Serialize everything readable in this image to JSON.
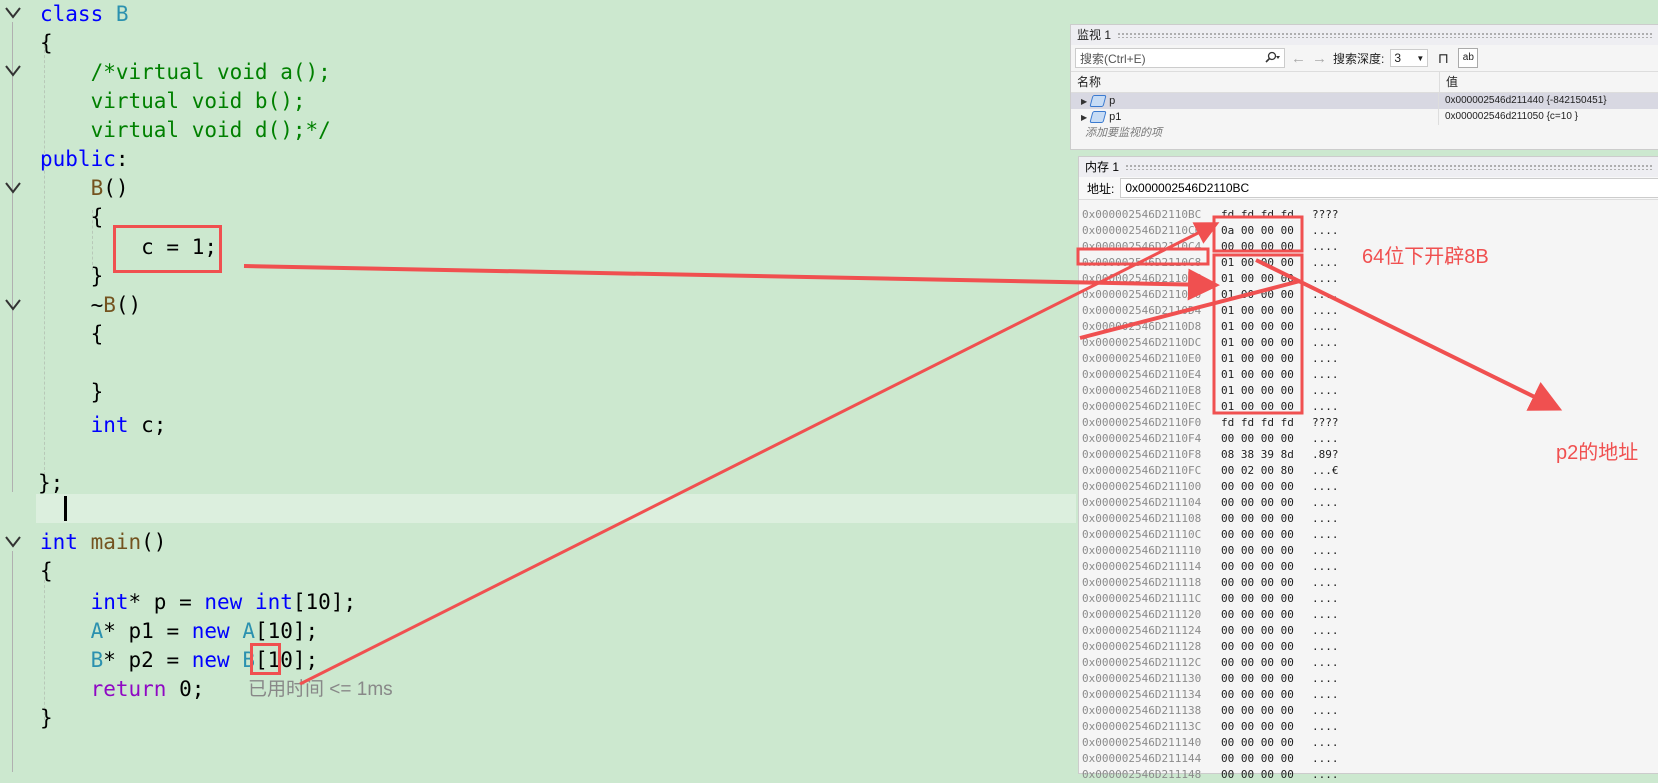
{
  "editor": {
    "lines": {
      "l0": [
        {
          "t": "class ",
          "c": "kw"
        },
        {
          "t": "B",
          "c": "ty"
        }
      ],
      "l1": [
        {
          "t": "{",
          "c": ""
        }
      ],
      "l2": [
        {
          "t": "    /*virtual void a();",
          "c": "cm"
        }
      ],
      "l3": [
        {
          "t": "    virtual void b();",
          "c": "cm"
        }
      ],
      "l4": [
        {
          "t": "    virtual void d();*/",
          "c": "cm"
        }
      ],
      "l5": [
        {
          "t": "public",
          "c": "kw"
        },
        {
          "t": ":",
          "c": ""
        }
      ],
      "l6": [
        {
          "t": "    ",
          "c": ""
        },
        {
          "t": "B",
          "c": "fn"
        },
        {
          "t": "()",
          "c": ""
        }
      ],
      "l7": [
        {
          "t": "    {",
          "c": ""
        }
      ],
      "l8": [
        {
          "t": "        c = 1;",
          "c": ""
        }
      ],
      "l9": [
        {
          "t": "    }",
          "c": ""
        }
      ],
      "l10": [
        {
          "t": "    ~",
          "c": ""
        },
        {
          "t": "B",
          "c": "fn"
        },
        {
          "t": "()",
          "c": ""
        }
      ],
      "l11": [
        {
          "t": "    {",
          "c": ""
        }
      ],
      "l12": [
        {
          "t": "",
          "c": ""
        }
      ],
      "l13": [
        {
          "t": "    }",
          "c": ""
        }
      ],
      "l14": [
        {
          "t": "    ",
          "c": ""
        },
        {
          "t": "int",
          "c": "kw"
        },
        {
          "t": " c;",
          "c": ""
        }
      ],
      "l15": [
        {
          "t": "",
          "c": ""
        }
      ],
      "l16": [
        {
          "t": "};",
          "c": ""
        }
      ],
      "l17": [
        {
          "t": "",
          "c": ""
        }
      ],
      "l18": [
        {
          "t": "int ",
          "c": "kw"
        },
        {
          "t": "main",
          "c": "fn"
        },
        {
          "t": "()",
          "c": ""
        }
      ],
      "l19": [
        {
          "t": "{",
          "c": ""
        }
      ],
      "l20": [
        {
          "t": "    ",
          "c": ""
        },
        {
          "t": "int",
          "c": "kw"
        },
        {
          "t": "* p = ",
          "c": ""
        },
        {
          "t": "new ",
          "c": "kw"
        },
        {
          "t": "int",
          "c": "kw"
        },
        {
          "t": "[10];",
          "c": ""
        }
      ],
      "l21": [
        {
          "t": "    ",
          "c": ""
        },
        {
          "t": "A",
          "c": "ty"
        },
        {
          "t": "* p1 = ",
          "c": ""
        },
        {
          "t": "new ",
          "c": "kw"
        },
        {
          "t": "A",
          "c": "ty"
        },
        {
          "t": "[10];",
          "c": ""
        }
      ],
      "l22": [
        {
          "t": "    ",
          "c": ""
        },
        {
          "t": "B",
          "c": "ty"
        },
        {
          "t": "* p2 = ",
          "c": ""
        },
        {
          "t": "new ",
          "c": "kw"
        },
        {
          "t": "B",
          "c": "ty"
        },
        {
          "t": "[10];",
          "c": ""
        }
      ],
      "l23": [
        {
          "t": "    ",
          "c": ""
        },
        {
          "t": "return",
          "c": "kw2"
        },
        {
          "t": " 0;",
          "c": ""
        }
      ],
      "l24": [
        {
          "t": "}",
          "c": ""
        }
      ]
    },
    "perf_hint": "已用时间 <= 1ms"
  },
  "watch": {
    "title": "监视 1",
    "search_placeholder": "搜索(Ctrl+E)",
    "search_icon": "search-icon",
    "depth_label": "搜索深度:",
    "depth_value": "3",
    "col_name": "名称",
    "col_value": "值",
    "rows": [
      {
        "name": "p",
        "value": "0x000002546d211440 {-842150451}"
      },
      {
        "name": "p1",
        "value": "0x000002546d211050 {c=10 }"
      }
    ],
    "add_hint": "添加要监视的项"
  },
  "memory": {
    "title": "内存 1",
    "addr_label": "地址:",
    "addr_value": "0x000002546D2110BC",
    "rows": [
      [
        "0x000002546D2110BC",
        "fd fd fd fd",
        "????"
      ],
      [
        "0x000002546D2110C0",
        "0a 00 00 00",
        "...."
      ],
      [
        "0x000002546D2110C4",
        "00 00 00 00",
        "...."
      ],
      [
        "0x000002546D2110C8",
        "01 00 00 00",
        "...."
      ],
      [
        "0x000002546D2110CC",
        "01 00 00 00",
        "...."
      ],
      [
        "0x000002546D2110D0",
        "01 00 00 00",
        "...."
      ],
      [
        "0x000002546D2110D4",
        "01 00 00 00",
        "...."
      ],
      [
        "0x000002546D2110D8",
        "01 00 00 00",
        "...."
      ],
      [
        "0x000002546D2110DC",
        "01 00 00 00",
        "...."
      ],
      [
        "0x000002546D2110E0",
        "01 00 00 00",
        "...."
      ],
      [
        "0x000002546D2110E4",
        "01 00 00 00",
        "...."
      ],
      [
        "0x000002546D2110E8",
        "01 00 00 00",
        "...."
      ],
      [
        "0x000002546D2110EC",
        "01 00 00 00",
        "...."
      ],
      [
        "0x000002546D2110F0",
        "fd fd fd fd",
        "????"
      ],
      [
        "0x000002546D2110F4",
        "00 00 00 00",
        "...."
      ],
      [
        "0x000002546D2110F8",
        "08 38 39 8d",
        ".89?"
      ],
      [
        "0x000002546D2110FC",
        "00 02 00 80",
        "...€"
      ],
      [
        "0x000002546D211100",
        "00 00 00 00",
        "...."
      ],
      [
        "0x000002546D211104",
        "00 00 00 00",
        "...."
      ],
      [
        "0x000002546D211108",
        "00 00 00 00",
        "...."
      ],
      [
        "0x000002546D21110C",
        "00 00 00 00",
        "...."
      ],
      [
        "0x000002546D211110",
        "00 00 00 00",
        "...."
      ],
      [
        "0x000002546D211114",
        "00 00 00 00",
        "...."
      ],
      [
        "0x000002546D211118",
        "00 00 00 00",
        "...."
      ],
      [
        "0x000002546D21111C",
        "00 00 00 00",
        "...."
      ],
      [
        "0x000002546D211120",
        "00 00 00 00",
        "...."
      ],
      [
        "0x000002546D211124",
        "00 00 00 00",
        "...."
      ],
      [
        "0x000002546D211128",
        "00 00 00 00",
        "...."
      ],
      [
        "0x000002546D21112C",
        "00 00 00 00",
        "...."
      ],
      [
        "0x000002546D211130",
        "00 00 00 00",
        "...."
      ],
      [
        "0x000002546D211134",
        "00 00 00 00",
        "...."
      ],
      [
        "0x000002546D211138",
        "00 00 00 00",
        "...."
      ],
      [
        "0x000002546D21113C",
        "00 00 00 00",
        "...."
      ],
      [
        "0x000002546D211140",
        "00 00 00 00",
        "...."
      ],
      [
        "0x000002546D211144",
        "00 00 00 00",
        "...."
      ],
      [
        "0x000002546D211148",
        "00 00 00 00",
        "...."
      ]
    ]
  },
  "annotations": {
    "note1": "64位下开辟8B",
    "note2": "p2的地址",
    "color": "#f05050"
  },
  "colors": {
    "editor_bg": "#cce8cf",
    "keyword": "#0000ff",
    "type": "#2b91af",
    "comment": "#008000",
    "return_kw": "#8f08c4"
  }
}
